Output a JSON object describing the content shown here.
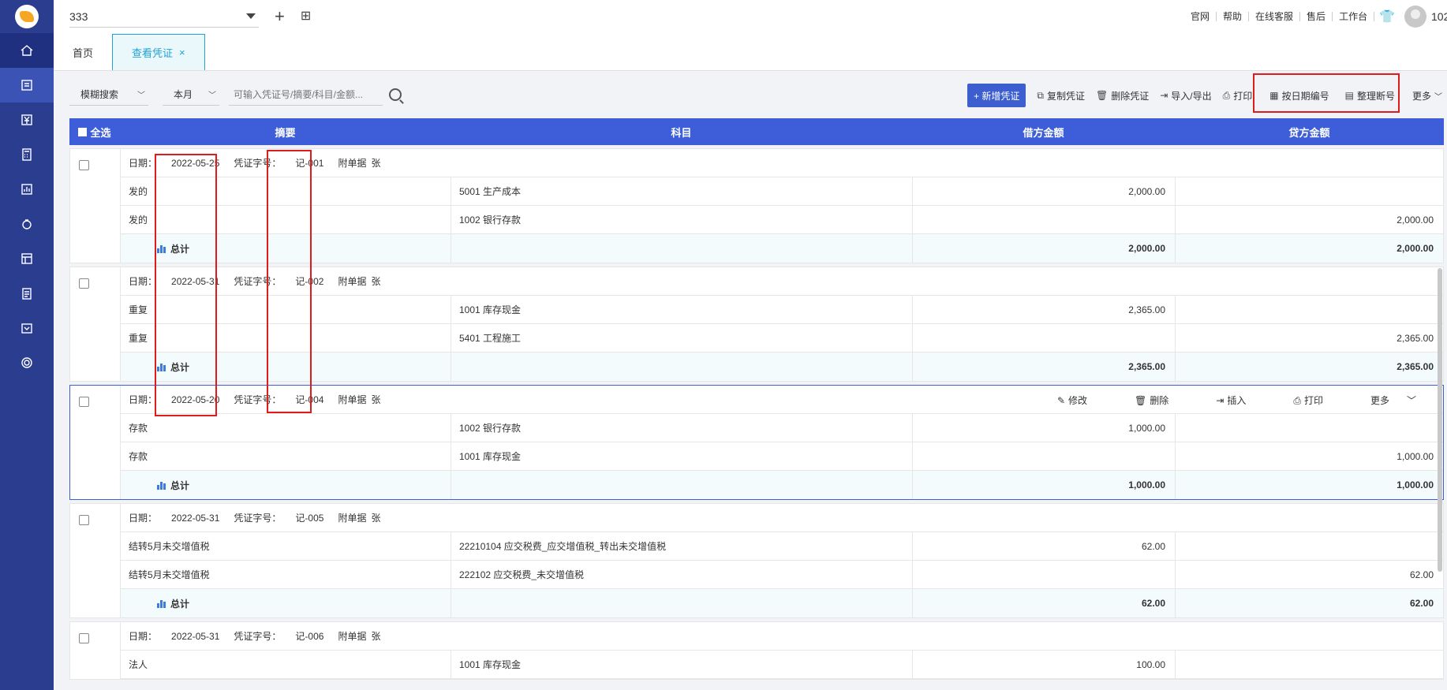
{
  "topbar": {
    "company": "333",
    "links": [
      "官网",
      "帮助",
      "在线客服",
      "售后",
      "工作台"
    ],
    "user": "102"
  },
  "tabs": [
    {
      "label": "首页"
    },
    {
      "label": "查看凭证",
      "close": "×"
    }
  ],
  "toolbar": {
    "search_mode": "模糊搜索",
    "period": "本月",
    "search_placeholder": "可输入凭证号/摘要/科目/金额...",
    "new_voucher": "+ 新增凭证",
    "copy": "复制凭证",
    "delete": "删除凭证",
    "import_export": "导入/导出",
    "print": "打印",
    "number_by_date": "按日期编号",
    "renumber": "整理断号",
    "more": "更多"
  },
  "table": {
    "headers": {
      "select_all": "全选",
      "summary": "摘要",
      "account": "科目",
      "debit": "借方金额",
      "credit": "贷方金额"
    },
    "date_label": "日期：",
    "no_label": "凭证字号：",
    "attach_label": "附单据",
    "attach_unit": "张",
    "total_label": "总计",
    "row_actions": {
      "edit": "修改",
      "delete": "删除",
      "insert": "插入",
      "print": "打印",
      "more": "更多"
    },
    "vouchers": [
      {
        "date": "2022-05-25",
        "no": "记-001",
        "rows": [
          {
            "summary": "发的",
            "account": "5001  生产成本",
            "debit": "2,000.00",
            "credit": ""
          },
          {
            "summary": "发的",
            "account": "1002  银行存款",
            "debit": "",
            "credit": "2,000.00"
          }
        ],
        "total_debit": "2,000.00",
        "total_credit": "2,000.00"
      },
      {
        "date": "2022-05-31",
        "no": "记-002",
        "rows": [
          {
            "summary": "重复",
            "account": "1001  库存现金",
            "debit": "2,365.00",
            "credit": ""
          },
          {
            "summary": "重复",
            "account": "5401  工程施工",
            "debit": "",
            "credit": "2,365.00"
          }
        ],
        "total_debit": "2,365.00",
        "total_credit": "2,365.00"
      },
      {
        "date": "2022-05-20",
        "no": "记-004",
        "rows": [
          {
            "summary": "存款",
            "account": "1002  银行存款",
            "debit": "1,000.00",
            "credit": ""
          },
          {
            "summary": "存款",
            "account": "1001  库存现金",
            "debit": "",
            "credit": "1,000.00"
          }
        ],
        "total_debit": "1,000.00",
        "total_credit": "1,000.00"
      },
      {
        "date": "2022-05-31",
        "no": "记-005",
        "rows": [
          {
            "summary": "结转5月未交增值税",
            "account": "22210104  应交税费_应交增值税_转出未交增值税",
            "debit": "62.00",
            "credit": ""
          },
          {
            "summary": "结转5月未交增值税",
            "account": "222102  应交税费_未交增值税",
            "debit": "",
            "credit": "62.00"
          }
        ],
        "total_debit": "62.00",
        "total_credit": "62.00"
      },
      {
        "date": "2022-05-31",
        "no": "记-006",
        "rows": [
          {
            "summary": "法人",
            "account": "1001  库存现金",
            "debit": "100.00",
            "credit": ""
          }
        ]
      }
    ]
  }
}
